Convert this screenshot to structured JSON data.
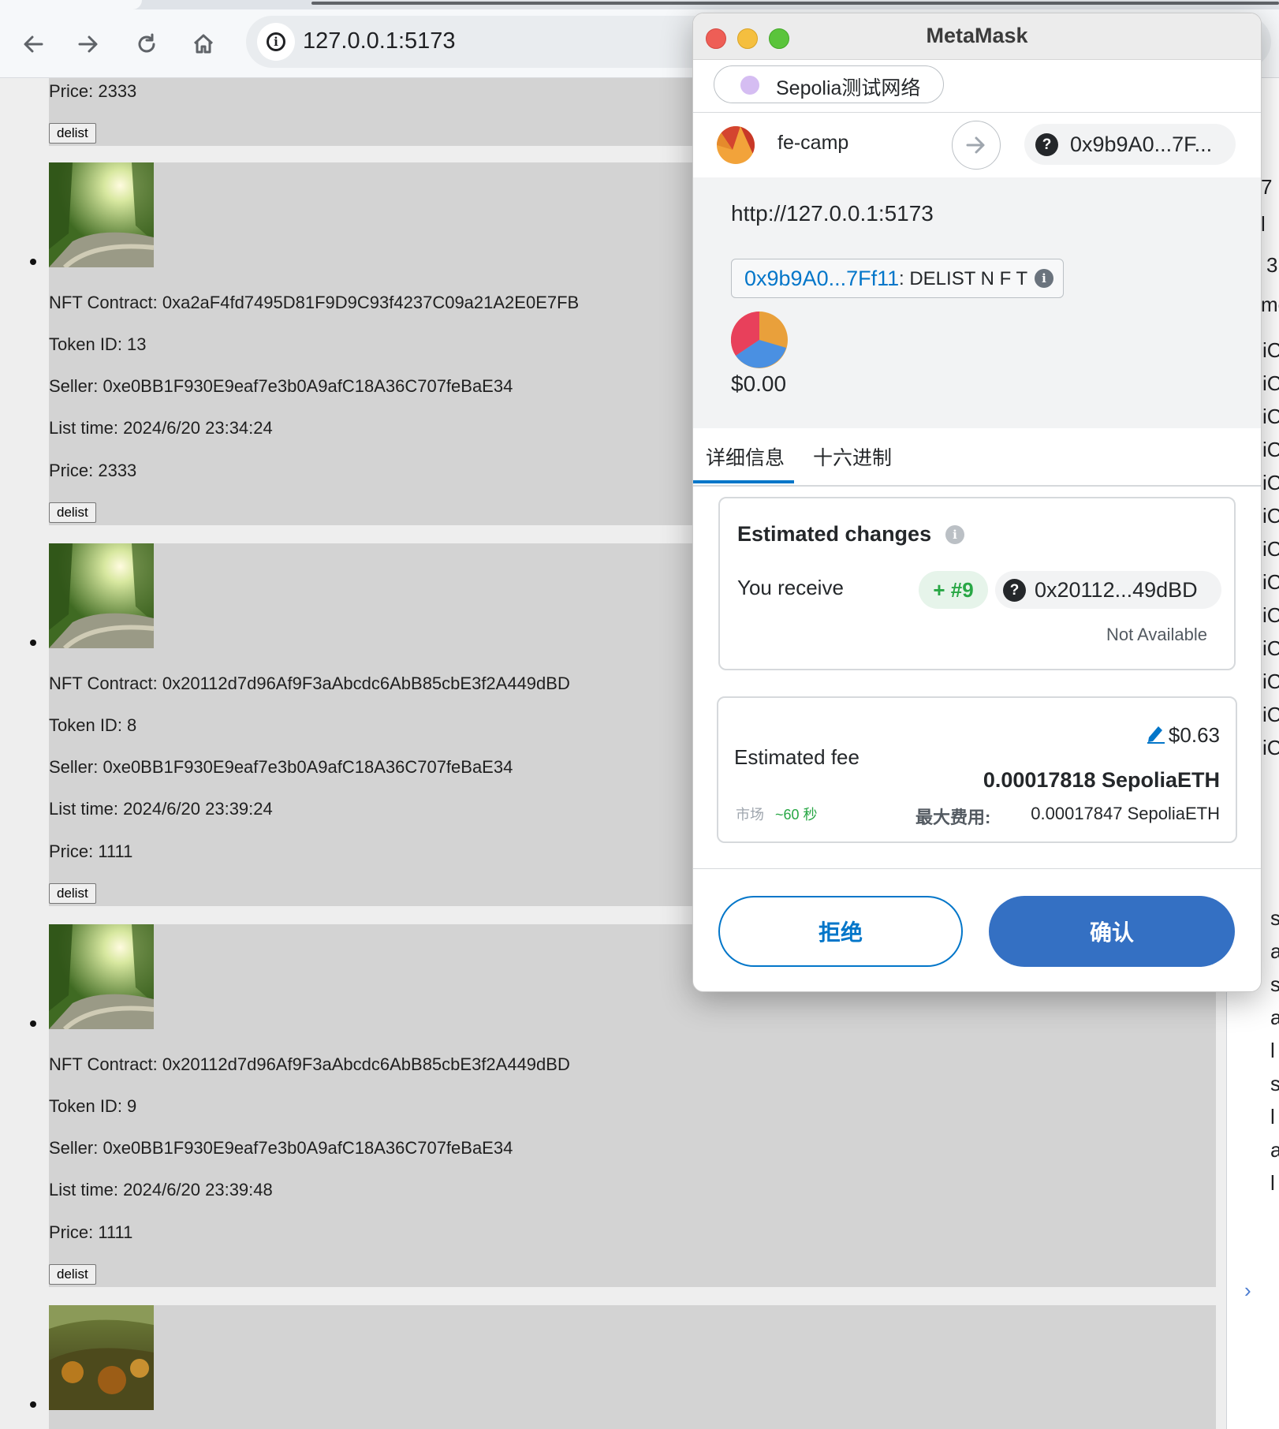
{
  "browser": {
    "url": "127.0.0.1:5173",
    "icons": {
      "back": "arrow-left-icon",
      "forward": "arrow-right-icon",
      "reload": "reload-icon",
      "home": "home-icon",
      "site_info": "info-icon"
    }
  },
  "listings": [
    {
      "price": "Price: 2333",
      "delist": "delist"
    },
    {
      "contract": "NFT Contract: 0xa2aF4fd7495D81F9D9C93f4237C09a21A2E0E7FB",
      "token": "Token ID: 13",
      "seller": "Seller: 0xe0BB1F930E9eaf7e3b0A9afC18A36C707feBaE34",
      "time": "List time: 2024/6/20 23:34:24",
      "price": "Price: 2333",
      "delist": "delist"
    },
    {
      "contract": "NFT Contract: 0x20112d7d96Af9F3aAbcdc6AbB85cbE3f2A449dBD",
      "token": "Token ID: 8",
      "seller": "Seller: 0xe0BB1F930E9eaf7e3b0A9afC18A36C707feBaE34",
      "time": "List time: 2024/6/20 23:39:24",
      "price": "Price: 1111",
      "delist": "delist"
    },
    {
      "contract": "NFT Contract: 0x20112d7d96Af9F3aAbcdc6AbB85cbE3f2A449dBD",
      "token": "Token ID: 9",
      "seller": "Seller: 0xe0BB1F930E9eaf7e3b0A9afC18A36C707feBaE34",
      "time": "List time: 2024/6/20 23:39:48",
      "price": "Price: 1111",
      "delist": "delist"
    }
  ],
  "devtools_fragments": [
    "7",
    "l",
    "3",
    "me",
    "iC",
    "s",
    "a",
    "l",
    "›"
  ],
  "metamask": {
    "title": "MetaMask",
    "network": "Sepolia测试网络",
    "from_account": "fe-camp",
    "to_address": "0x9b9A0...7F...",
    "origin": "http://127.0.0.1:5173",
    "method_address": "0x9b9A0...7Ff11",
    "method_name": ": DELIST N F T",
    "usd_value": "$0.00",
    "tabs": {
      "details": "详细信息",
      "hex": "十六进制"
    },
    "estimated_changes": {
      "title": "Estimated changes",
      "receive_label": "You receive",
      "token_badge": "+ #9",
      "token_address": "0x20112...49dBD",
      "availability": "Not Available"
    },
    "fee": {
      "label": "Estimated fee",
      "usd": "$0.63",
      "eth": "0.00017818 SepoliaETH",
      "market_label": "市场",
      "time": "~60 秒",
      "max_label": "最大费用:",
      "max_value": "0.00017847 SepoliaETH"
    },
    "buttons": {
      "reject": "拒绝",
      "confirm": "确认"
    },
    "colors": {
      "primary": "#0376c9",
      "confirm_bg": "#3470c3",
      "success": "#28a745"
    }
  }
}
